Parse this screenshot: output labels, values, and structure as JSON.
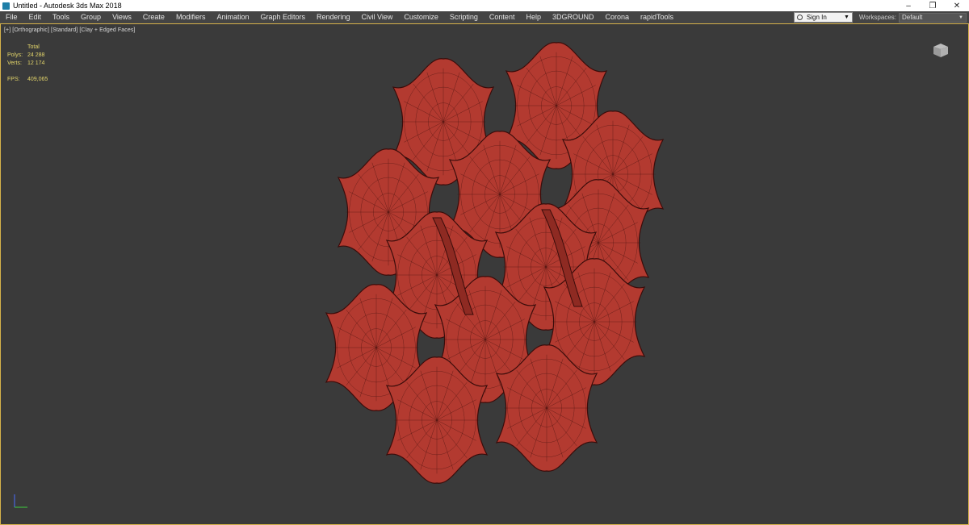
{
  "window": {
    "title": "Untitled - Autodesk 3ds Max 2018",
    "minimize": "–",
    "restore": "❐",
    "close": "✕"
  },
  "menu": {
    "items": [
      "File",
      "Edit",
      "Tools",
      "Group",
      "Views",
      "Create",
      "Modifiers",
      "Animation",
      "Graph Editors",
      "Rendering",
      "Civil View",
      "Customize",
      "Scripting",
      "Content",
      "Help",
      "3DGROUND",
      "Corona",
      "rapidTools"
    ],
    "sign_in": "Sign In",
    "workspaces_label": "Workspaces:",
    "workspaces_value": "Default"
  },
  "viewport": {
    "label_plus": "[+]",
    "label_view": "[Orthographic]",
    "label_shading": "[Standard]",
    "label_style": "[Clay + Edged Faces]",
    "stats": {
      "header": "Total",
      "polys_label": "Polys:",
      "polys_value": "24 288",
      "verts_label": "Verts:",
      "verts_value": "12 174",
      "fps_label": "FPS:",
      "fps_value": "409,065"
    },
    "viewcube_icon": "viewcube-icon",
    "axis_icon": "axis-tripod-icon"
  },
  "colors": {
    "menubar": "#444444",
    "viewport_bg": "#3a3a3a",
    "viewport_border": "#d6b24a",
    "stats_text": "#e2d46a",
    "mesh_fill": "#b33a30",
    "mesh_edge": "#3a0c0a"
  }
}
